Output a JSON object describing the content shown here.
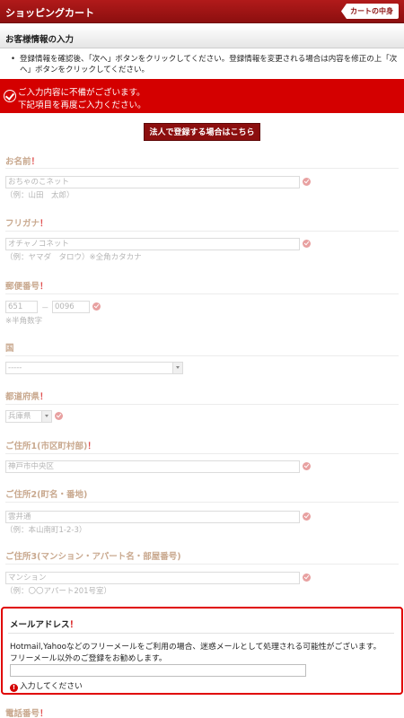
{
  "header": {
    "title": "ショッピングカート",
    "cart_button": "カートの中身"
  },
  "section": {
    "title": "お客様情報の入力"
  },
  "notice": {
    "bullet": "•",
    "text": "登録情報を確認後、「次へ」ボタンをクリックしてください。登録情報を変更される場合は内容を修正の上「次へ」ボタンをクリックしてください。"
  },
  "error_banner": {
    "line1": "ご入力内容に不備がございます。",
    "line2": "下記項目を再度ご入力ください。"
  },
  "corporate_button": "法人で登録する場合はこちら",
  "fields": {
    "name": {
      "label": "お名前",
      "required": "！",
      "value": "おちゃのこネット",
      "hint": "（例：山田　太郎）"
    },
    "furigana": {
      "label": "フリガナ",
      "required": "！",
      "value": "オチャノコネット",
      "hint": "（例：ヤマダ　タロウ）※全角カタカナ"
    },
    "postal": {
      "label": "郵便番号",
      "required": "！",
      "value1": "651",
      "separator": "－",
      "value2": "0096",
      "hint": "※半角数字"
    },
    "country": {
      "label": "国",
      "selected": "-----"
    },
    "prefecture": {
      "label": "都道府県",
      "required": "！",
      "selected": "兵庫県"
    },
    "address1": {
      "label": "ご住所1(市区町村部)",
      "required": "！",
      "value": "神戸市中央区"
    },
    "address2": {
      "label": "ご住所2(町名・番地)",
      "value": "雲井通",
      "hint": "（例：本山南町1-2-3）"
    },
    "address3": {
      "label": "ご住所3(マンション・アパート名・部屋番号)",
      "value": "マンション",
      "hint": "（例：〇〇アパート201号室）"
    },
    "email": {
      "label": "メールアドレス",
      "required": "！",
      "desc1": "Hotmail,Yahooなどのフリーメールをご利用の場合、迷惑メールとして処理される可能性がございます。",
      "desc2": "フリーメール以外のご登録をお勧めします。",
      "value": "",
      "error_icon": "!",
      "error": "入力してください"
    },
    "phone": {
      "label": "電話番号",
      "required": "！"
    }
  },
  "colors": {
    "brand": "#8c0f0f",
    "error": "#d40000",
    "label": "#c9a98f"
  }
}
